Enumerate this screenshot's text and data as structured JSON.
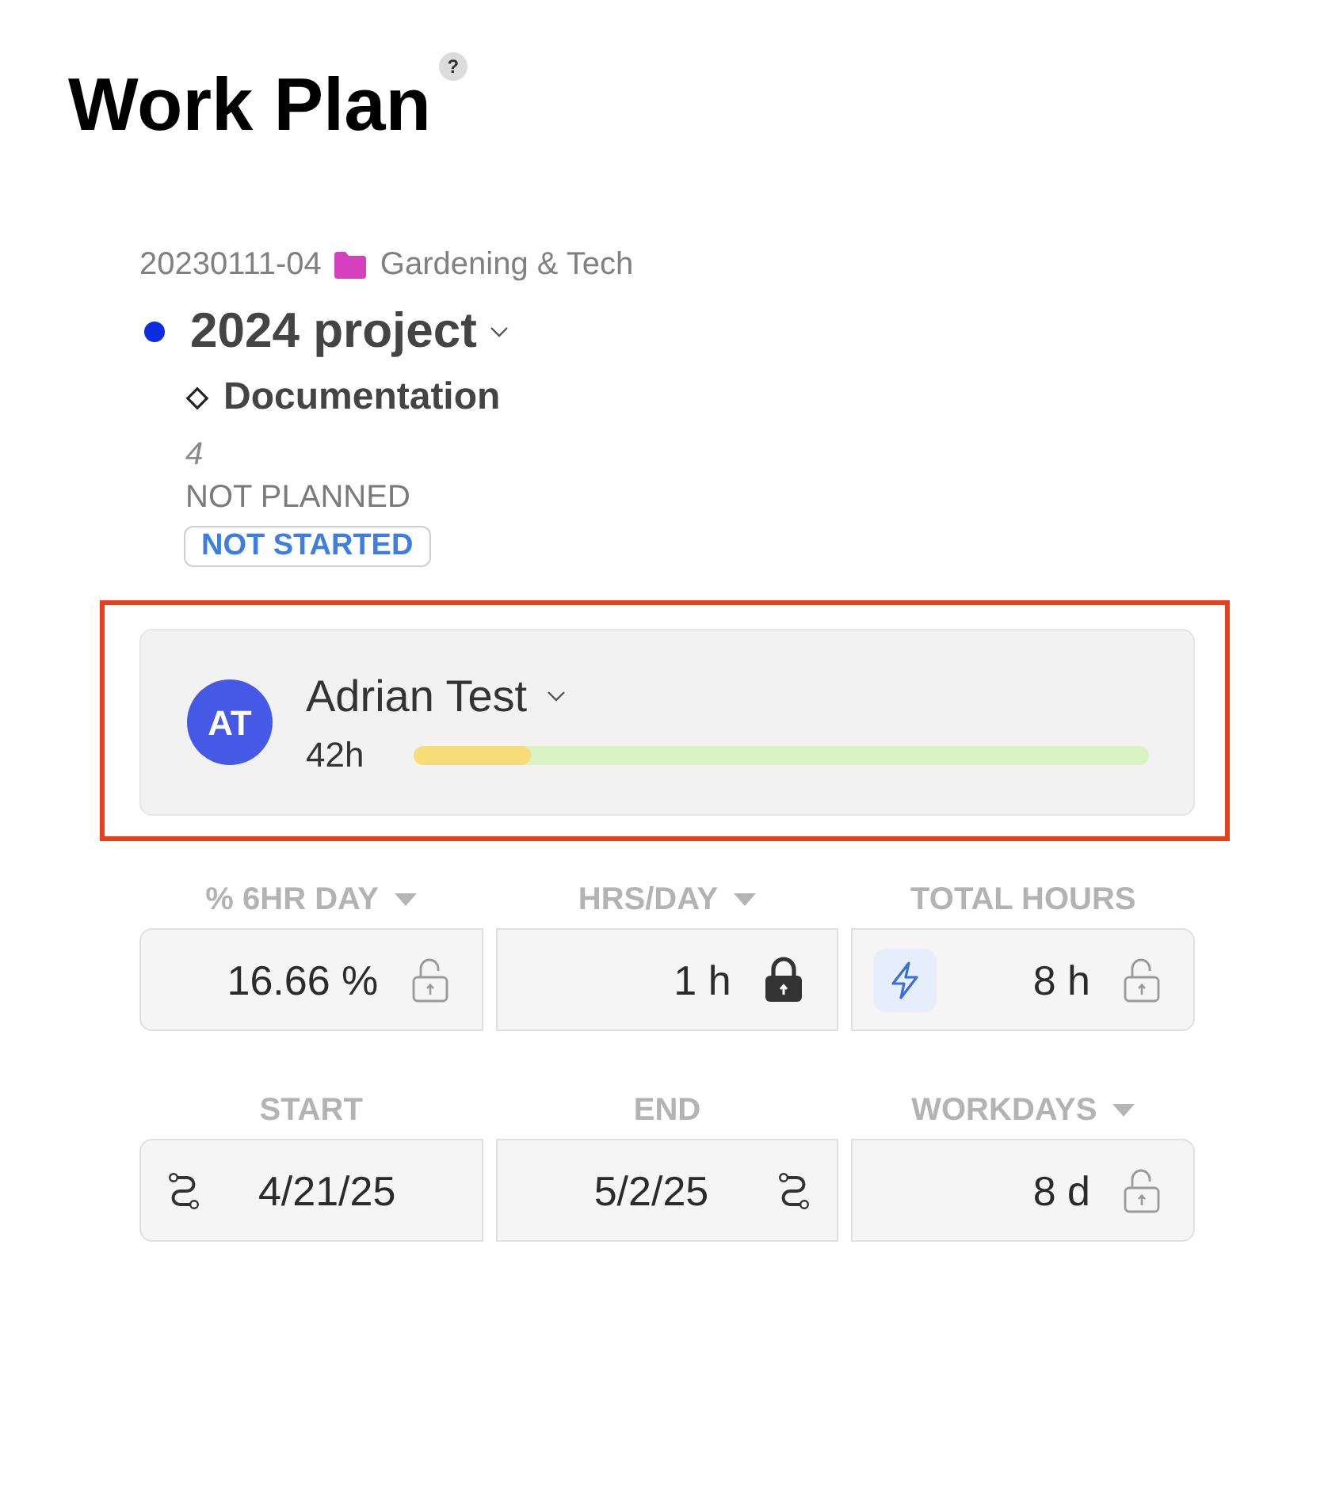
{
  "page": {
    "title": "Work Plan",
    "help": "?"
  },
  "task": {
    "code": "20230111-04",
    "folder": "Gardening & Tech",
    "project": "2024 project",
    "phase": "Documentation",
    "number": "4",
    "plan_status": "NOT PLANNED",
    "status": "NOT STARTED"
  },
  "assignee": {
    "initials": "AT",
    "name": "Adrian Test",
    "hours": "42h",
    "level": 0.16,
    "highlighted": true
  },
  "fields": [
    {
      "kind": "number",
      "label": "% 6HR DAY",
      "menu": true,
      "value": "16.66 %",
      "locked": false,
      "auto": false
    },
    {
      "kind": "number",
      "label": "HRS/DAY",
      "menu": true,
      "value": "1 h",
      "locked": true,
      "auto": false
    },
    {
      "kind": "number",
      "label": "TOTAL HOURS",
      "menu": false,
      "value": "8 h",
      "locked": false,
      "auto": true
    },
    {
      "kind": "date",
      "label": "START",
      "menu": false,
      "value": "4/21/25",
      "icon_trailing": false
    },
    {
      "kind": "date",
      "label": "END",
      "menu": false,
      "value": "5/2/25",
      "icon_trailing": true
    },
    {
      "kind": "number",
      "label": "WORKDAYS",
      "menu": true,
      "value": "8 d",
      "locked": false,
      "auto": false
    }
  ]
}
